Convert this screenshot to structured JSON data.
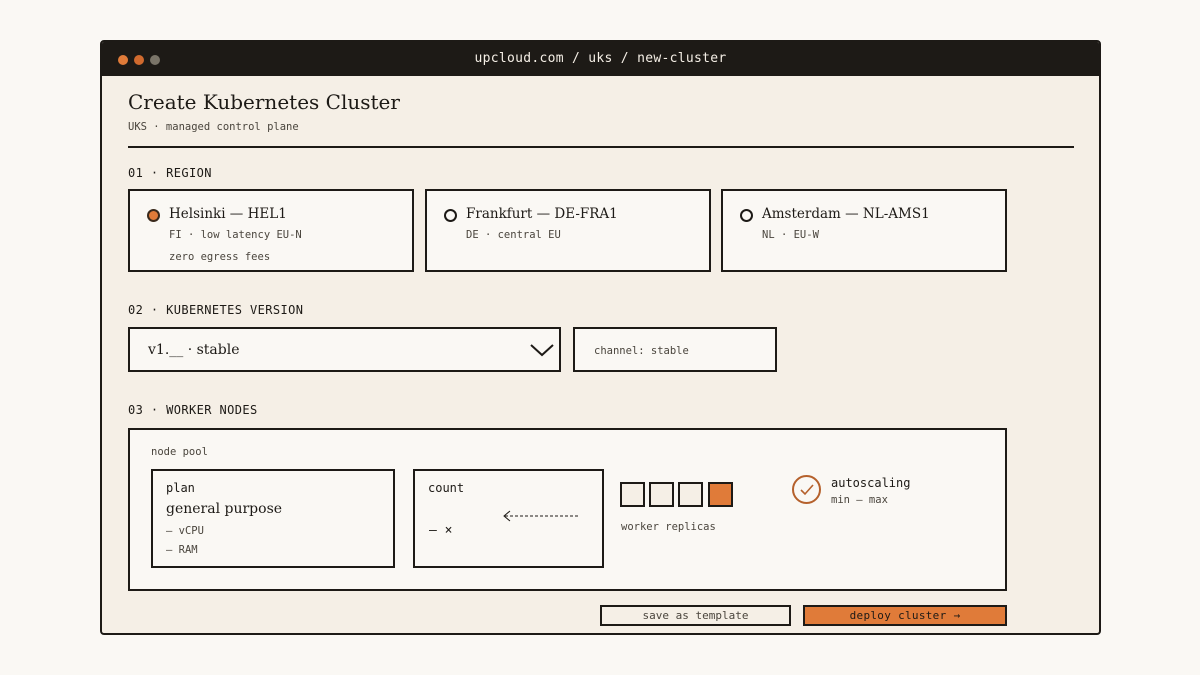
{
  "window": {
    "url": "upcloud.com / uks / new-cluster"
  },
  "page": {
    "title": "Create Kubernetes Cluster",
    "subtitle": "UKS · managed control plane"
  },
  "sections": {
    "region": "01 · REGION",
    "version": "02 · KUBERNETES VERSION",
    "workers": "03 · WORKER NODES"
  },
  "regions": [
    {
      "name": "Helsinki — HEL1",
      "meta1": "FI · low latency EU-N",
      "meta2": "zero egress fees",
      "selected": true
    },
    {
      "name": "Frankfurt — DE-FRA1",
      "meta1": "DE · central EU",
      "meta2": "",
      "selected": false
    },
    {
      "name": "Amsterdam — NL-AMS1",
      "meta1": "NL · EU-W",
      "meta2": "",
      "selected": false
    }
  ],
  "version": {
    "selected": "v1.__ · stable",
    "channel": "channel: stable"
  },
  "node_pool": {
    "label": "node pool",
    "plan_label": "plan",
    "plan_value": "general purpose",
    "cpu": "— vCPU",
    "ram": "— RAM",
    "count_label": "count",
    "count_value": "— ×",
    "replicas_total": 4,
    "replicas_active_index": 3,
    "replicas_label": "worker replicas",
    "autoscaling_title": "autoscaling",
    "autoscaling_range": "min — max"
  },
  "actions": {
    "save_template": "save as template",
    "deploy": "deploy cluster →"
  },
  "colors": {
    "accent": "#e07b39",
    "ink": "#1d1a16",
    "paper": "#f5efe6"
  }
}
